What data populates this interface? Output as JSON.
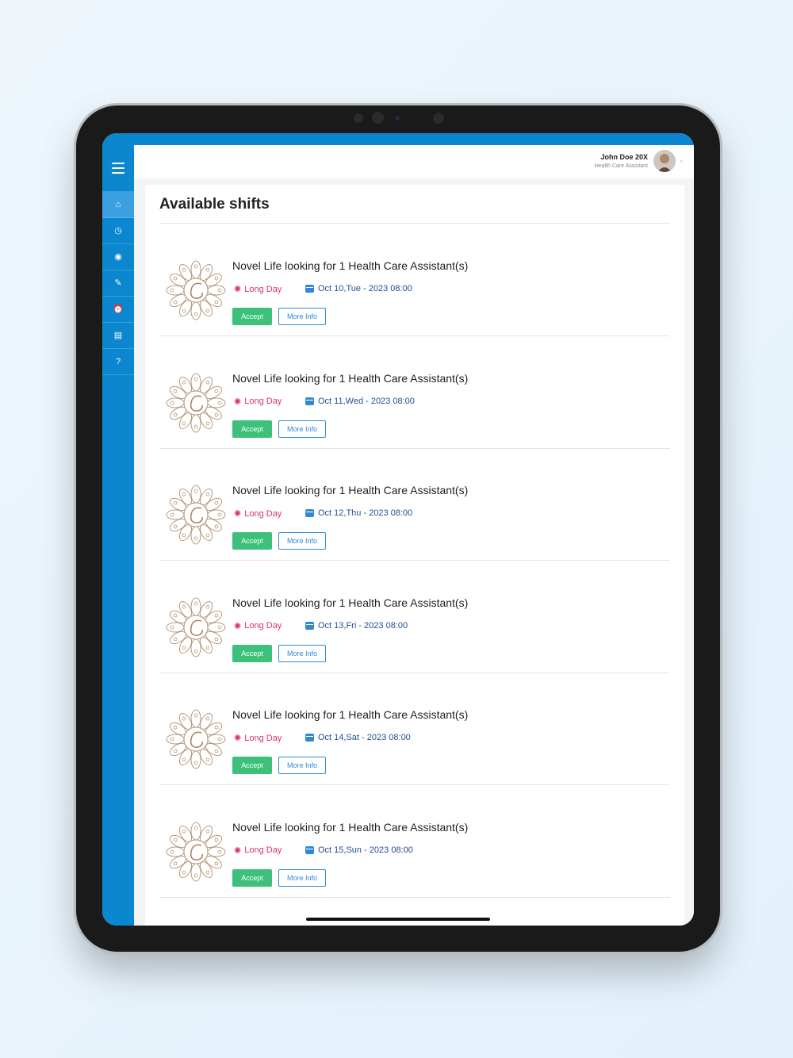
{
  "header": {
    "user_name": "John Doe 20X",
    "user_role": "Health Care Assistant"
  },
  "sidebar": {
    "items": [
      {
        "icon": "home-icon",
        "glyph": "⌂"
      },
      {
        "icon": "clock-icon",
        "glyph": "◷"
      },
      {
        "icon": "target-icon",
        "glyph": "◉"
      },
      {
        "icon": "edit-icon",
        "glyph": "✎"
      },
      {
        "icon": "alarm-icon",
        "glyph": "⏰"
      },
      {
        "icon": "document-icon",
        "glyph": "▤"
      },
      {
        "icon": "help-icon",
        "glyph": "?"
      }
    ]
  },
  "page": {
    "title": "Available shifts"
  },
  "shifts": [
    {
      "title": "Novel Life looking for 1 Health Care Assistant(s)",
      "type": "Long Day",
      "date": "Oct 10,Tue - 2023 08:00",
      "accept": "Accept",
      "more": "More Info"
    },
    {
      "title": "Novel Life looking for 1 Health Care Assistant(s)",
      "type": "Long Day",
      "date": "Oct 11,Wed - 2023 08:00",
      "accept": "Accept",
      "more": "More Info"
    },
    {
      "title": "Novel Life looking for 1 Health Care Assistant(s)",
      "type": "Long Day",
      "date": "Oct 12,Thu - 2023 08:00",
      "accept": "Accept",
      "more": "More Info"
    },
    {
      "title": "Novel Life looking for 1 Health Care Assistant(s)",
      "type": "Long Day",
      "date": "Oct 13,Fri - 2023 08:00",
      "accept": "Accept",
      "more": "More Info"
    },
    {
      "title": "Novel Life looking for 1 Health Care Assistant(s)",
      "type": "Long Day",
      "date": "Oct 14,Sat - 2023 08:00",
      "accept": "Accept",
      "more": "More Info"
    },
    {
      "title": "Novel Life looking for 1 Health Care Assistant(s)",
      "type": "Long Day",
      "date": "Oct 15,Sun - 2023 08:00",
      "accept": "Accept",
      "more": "More Info"
    }
  ],
  "colors": {
    "brand": "#0a87cf",
    "accept": "#3cc07a",
    "tag": "#d6336c",
    "date": "#1f4e8c"
  }
}
